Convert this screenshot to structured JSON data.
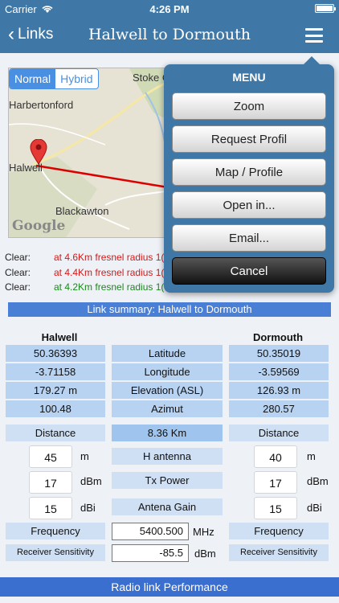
{
  "status": {
    "carrier": "Carrier",
    "time": "4:26 PM"
  },
  "nav": {
    "back_label": "Links",
    "title": "Halwell to Dormouth"
  },
  "map": {
    "mode_normal": "Normal",
    "mode_hybrid": "Hybrid",
    "selected_mode": "Normal",
    "places": {
      "p1": "Harbertonford",
      "p2": "Halwell",
      "p3": "Blackawton",
      "p4": "Stoke C"
    },
    "attribution": "Google",
    "link_color": "#dd0000"
  },
  "clearance": [
    {
      "label": "Clear:",
      "text": "at 4.6Km  fresnel radius 1(",
      "color": "red"
    },
    {
      "label": "Clear:",
      "text": "at 4.4Km  fresnel radius 1(",
      "color": "red"
    },
    {
      "label": "Clear:",
      "text": "at 4.2Km fresnel radius 1(",
      "color": "green"
    }
  ],
  "summary": "Link summary: Halwell to Dormouth",
  "site_a": {
    "name": "Halwell",
    "lat": "50.36393",
    "lon": "-3.71158",
    "elev": "179.27 m",
    "azimut": "100.48",
    "h_antenna": "45",
    "tx_power": "17",
    "gain": "15"
  },
  "site_b": {
    "name": "Dormouth",
    "lat": "50.35019",
    "lon": "-3.59569",
    "elev": "126.93 m",
    "azimut": "280.57",
    "h_antenna": "40",
    "tx_power": "17",
    "gain": "15"
  },
  "labels": {
    "lat": "Latitude",
    "lon": "Longitude",
    "elev": "Elevation (ASL)",
    "azimut": "Azimut",
    "distance": "Distance",
    "h_antenna": "H antenna",
    "tx_power": "Tx Power",
    "gain": "Antena Gain",
    "frequency": "Frequency",
    "sensitivity": "Receiver Sensitivity"
  },
  "distance_value": "8.36 Km",
  "units": {
    "m": "m",
    "dbm": "dBm",
    "dbi": "dBi",
    "mhz": "MHz"
  },
  "frequency_value": "5400.500",
  "sensitivity_value": "-85.5",
  "footer": "Radio link Performance",
  "menu": {
    "title": "MENU",
    "items": [
      "Zoom",
      "Request Profil",
      "Map / Profile",
      "Open in...",
      "Email...",
      "Cancel"
    ]
  }
}
